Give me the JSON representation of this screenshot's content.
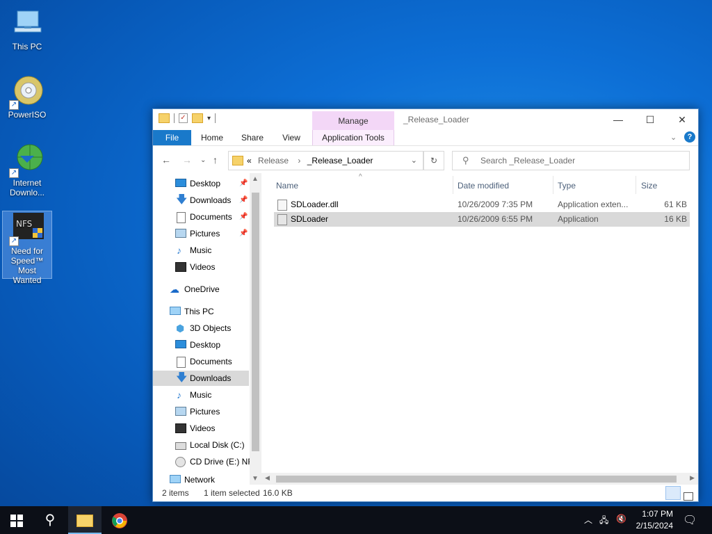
{
  "desktop": {
    "icons": [
      {
        "label": "This PC"
      },
      {
        "label": "PowerISO"
      },
      {
        "label": "Internet Downlo..."
      },
      {
        "label": "Need for Speed™ Most Wanted"
      }
    ]
  },
  "window": {
    "title": "_Release_Loader",
    "manage_tab": "Manage",
    "ribbon_tabs": [
      "File",
      "Home",
      "Share",
      "View",
      "Application Tools"
    ],
    "address": {
      "overflow": "«",
      "crumbs": [
        "Release",
        "_Release_Loader"
      ]
    },
    "search": {
      "placeholder": "Search _Release_Loader"
    },
    "nav": {
      "items": [
        {
          "label": "Desktop",
          "icon": "desktop-icon",
          "pinned": true
        },
        {
          "label": "Downloads",
          "icon": "download-icon",
          "pinned": true
        },
        {
          "label": "Documents",
          "icon": "document-icon",
          "pinned": true
        },
        {
          "label": "Pictures",
          "icon": "pictures-icon",
          "pinned": true
        },
        {
          "label": "Music",
          "icon": "music-icon",
          "pinned": false
        },
        {
          "label": "Videos",
          "icon": "videos-icon",
          "pinned": false
        },
        {
          "label": "OneDrive",
          "icon": "cloud-icon",
          "pinned": false
        },
        {
          "label": "This PC",
          "icon": "computer-icon",
          "pinned": false
        },
        {
          "label": "3D Objects",
          "icon": "cube-icon",
          "pinned": false
        },
        {
          "label": "Desktop",
          "icon": "desktop-icon",
          "pinned": false
        },
        {
          "label": "Documents",
          "icon": "document-icon",
          "pinned": false
        },
        {
          "label": "Downloads",
          "icon": "download-icon",
          "pinned": false,
          "selected": true
        },
        {
          "label": "Music",
          "icon": "music-icon",
          "pinned": false
        },
        {
          "label": "Pictures",
          "icon": "pictures-icon",
          "pinned": false
        },
        {
          "label": "Videos",
          "icon": "videos-icon",
          "pinned": false
        },
        {
          "label": "Local Disk (C:)",
          "icon": "drive-icon",
          "pinned": false
        },
        {
          "label": "CD Drive (E:) NFS",
          "icon": "cd-icon",
          "pinned": false
        },
        {
          "label": "Network",
          "icon": "network-icon",
          "pinned": false
        }
      ]
    },
    "columns": [
      "Name",
      "Date modified",
      "Type",
      "Size"
    ],
    "files": [
      {
        "name": "SDLoader.dll",
        "date": "10/26/2009 7:35 PM",
        "type": "Application exten...",
        "size": "61 KB",
        "selected": false
      },
      {
        "name": "SDLoader",
        "date": "10/26/2009 6:55 PM",
        "type": "Application",
        "size": "16 KB",
        "selected": true
      }
    ],
    "status": {
      "items": "2 items",
      "selected": "1 item selected",
      "size": "16.0 KB"
    }
  },
  "taskbar": {
    "time": "1:07 PM",
    "date": "2/15/2024"
  },
  "colors": {
    "file_tab": "#1979ca",
    "manage_tab": "#f3d7f7",
    "selection": "#d9d9d9",
    "taskbar": "#0c0f17"
  }
}
